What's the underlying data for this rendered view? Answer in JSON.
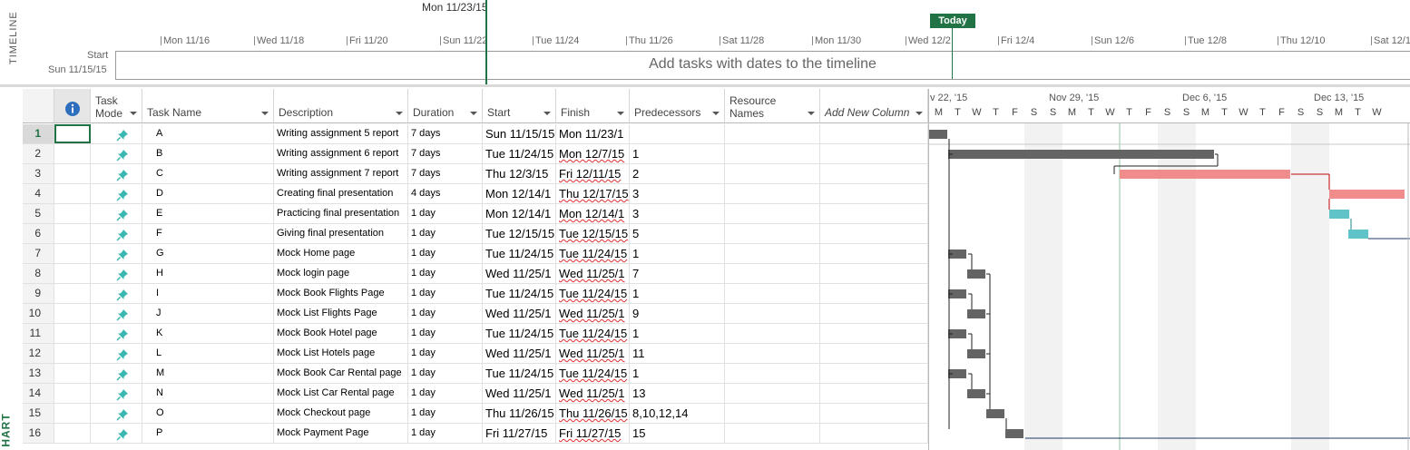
{
  "timeline": {
    "side_label": "TIMELINE",
    "current_date": "Mon 11/23/15",
    "today_label": "Today",
    "start_label": "Start",
    "start_date": "Sun 11/15/15",
    "placeholder": "Add tasks with dates to the timeline",
    "dates": [
      "Mon 11/16",
      "Wed 11/18",
      "Fri 11/20",
      "Sun 11/22",
      "Tue 11/24",
      "Thu 11/26",
      "Sat 11/28",
      "Mon 11/30",
      "Wed 12/2",
      "Fri 12/4",
      "Sun 12/6",
      "Tue 12/8",
      "Thu 12/10",
      "Sat 12/1"
    ]
  },
  "gantt_side_label": "HART",
  "columns": {
    "task_mode": "Task Mode",
    "task_name": "Task Name",
    "description": "Description",
    "duration": "Duration",
    "start": "Start",
    "finish": "Finish",
    "predecessors": "Predecessors",
    "resource_names": "Resource Names",
    "add_new_column": "Add New Column"
  },
  "tasks": [
    {
      "id": "1",
      "name": "A",
      "description": "Writing assignment 5 report",
      "duration": "7 days",
      "start": "Sun 11/15/15",
      "finish": "Mon 11/23/1",
      "predecessors": ""
    },
    {
      "id": "2",
      "name": "B",
      "description": "Writing assignment 6 report",
      "duration": "7 days",
      "start": "Tue 11/24/15",
      "finish": "Mon 12/7/15",
      "predecessors": "1"
    },
    {
      "id": "3",
      "name": "C",
      "description": "Writing assignment 7 report",
      "duration": "7 days",
      "start": "Thu 12/3/15",
      "finish": "Fri 12/11/15",
      "predecessors": "2"
    },
    {
      "id": "4",
      "name": "D",
      "description": "Creating final presentation",
      "duration": "4 days",
      "start": "Mon 12/14/1",
      "finish": "Thu 12/17/15",
      "predecessors": "3"
    },
    {
      "id": "5",
      "name": "E",
      "description": "Practicing final presentation",
      "duration": "1 day",
      "start": "Mon 12/14/1",
      "finish": "Mon 12/14/1",
      "predecessors": "3"
    },
    {
      "id": "6",
      "name": "F",
      "description": "Giving final presentation",
      "duration": "1 day",
      "start": "Tue 12/15/15",
      "finish": "Tue 12/15/15",
      "predecessors": "5"
    },
    {
      "id": "7",
      "name": "G",
      "description": "Mock Home page",
      "duration": "1 day",
      "start": "Tue 11/24/15",
      "finish": "Tue 11/24/15",
      "predecessors": "1"
    },
    {
      "id": "8",
      "name": "H",
      "description": "Mock login page",
      "duration": "1 day",
      "start": "Wed 11/25/1",
      "finish": "Wed 11/25/1",
      "predecessors": "7"
    },
    {
      "id": "9",
      "name": "I",
      "description": "Mock Book Flights Page",
      "duration": "1 day",
      "start": "Tue 11/24/15",
      "finish": "Tue 11/24/15",
      "predecessors": "1"
    },
    {
      "id": "10",
      "name": "J",
      "description": "Mock List Flights Page",
      "duration": "1 day",
      "start": "Wed 11/25/1",
      "finish": "Wed 11/25/1",
      "predecessors": "9"
    },
    {
      "id": "11",
      "name": "K",
      "description": "Mock Book Hotel page",
      "duration": "1 day",
      "start": "Tue 11/24/15",
      "finish": "Tue 11/24/15",
      "predecessors": "1"
    },
    {
      "id": "12",
      "name": "L",
      "description": "Mock List Hotels page",
      "duration": "1 day",
      "start": "Wed 11/25/1",
      "finish": "Wed 11/25/1",
      "predecessors": "11"
    },
    {
      "id": "13",
      "name": "M",
      "description": "Mock Book Car Rental page",
      "duration": "1 day",
      "start": "Tue 11/24/15",
      "finish": "Tue 11/24/15",
      "predecessors": "1"
    },
    {
      "id": "14",
      "name": "N",
      "description": "Mock List Car Rental page",
      "duration": "1 day",
      "start": "Wed 11/25/1",
      "finish": "Wed 11/25/1",
      "predecessors": "13"
    },
    {
      "id": "15",
      "name": "O",
      "description": "Mock Checkout page",
      "duration": "1 day",
      "start": "Thu 11/26/15",
      "finish": "Thu 11/26/15",
      "predecessors": "8,10,12,14"
    },
    {
      "id": "16",
      "name": "P",
      "description": "Mock Payment Page",
      "duration": "1 day",
      "start": "Fri 11/27/15",
      "finish": "Fri 11/27/15",
      "predecessors": "15"
    }
  ],
  "gantt_header": {
    "weeks": [
      "v 22, '15",
      "Nov 29, '15",
      "Dec 6, '15",
      "Dec 13, '15"
    ],
    "days": [
      "M",
      "T",
      "W",
      "T",
      "F",
      "S",
      "S",
      "M",
      "T",
      "W",
      "T",
      "F",
      "S",
      "S",
      "M",
      "T",
      "W",
      "T",
      "F",
      "S",
      "S",
      "M",
      "T",
      "W"
    ]
  },
  "colors": {
    "accent": "#217346",
    "bar_normal": "#646464",
    "bar_critical": "#f08c8c",
    "bar_teal": "#5fc3c8",
    "pin": "#39b7b0"
  }
}
